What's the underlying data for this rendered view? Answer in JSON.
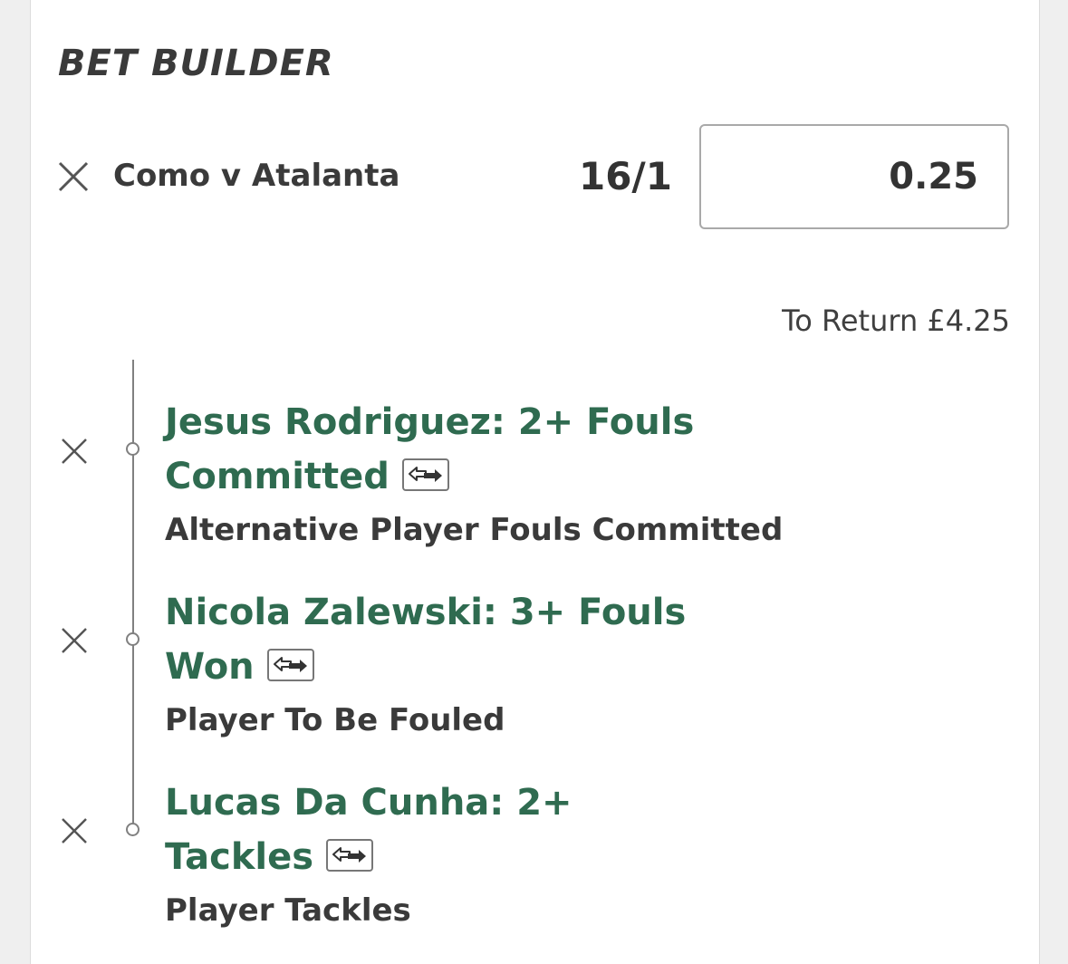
{
  "header": {
    "title": "BET BUILDER"
  },
  "bet": {
    "match": "Como v Atalanta",
    "odds": "16/1",
    "stake_value": "0.25",
    "to_return": "To Return £4.25"
  },
  "selections": [
    {
      "title": "Jesus Rodriguez: 2+ Fouls Committed",
      "market": "Alternative Player Fouls Committed"
    },
    {
      "title": "Nicola Zalewski: 3+ Fouls Won",
      "market": "Player To Be Fouled"
    },
    {
      "title": "Lucas Da Cunha: 2+ Tackles",
      "market": "Player Tackles"
    }
  ],
  "icons": {
    "remove": "close-icon",
    "swap": "swap-icon"
  },
  "colors": {
    "selection_green": "#2f6b50",
    "text_dark": "#3a3a3a",
    "background": "#efefef"
  }
}
